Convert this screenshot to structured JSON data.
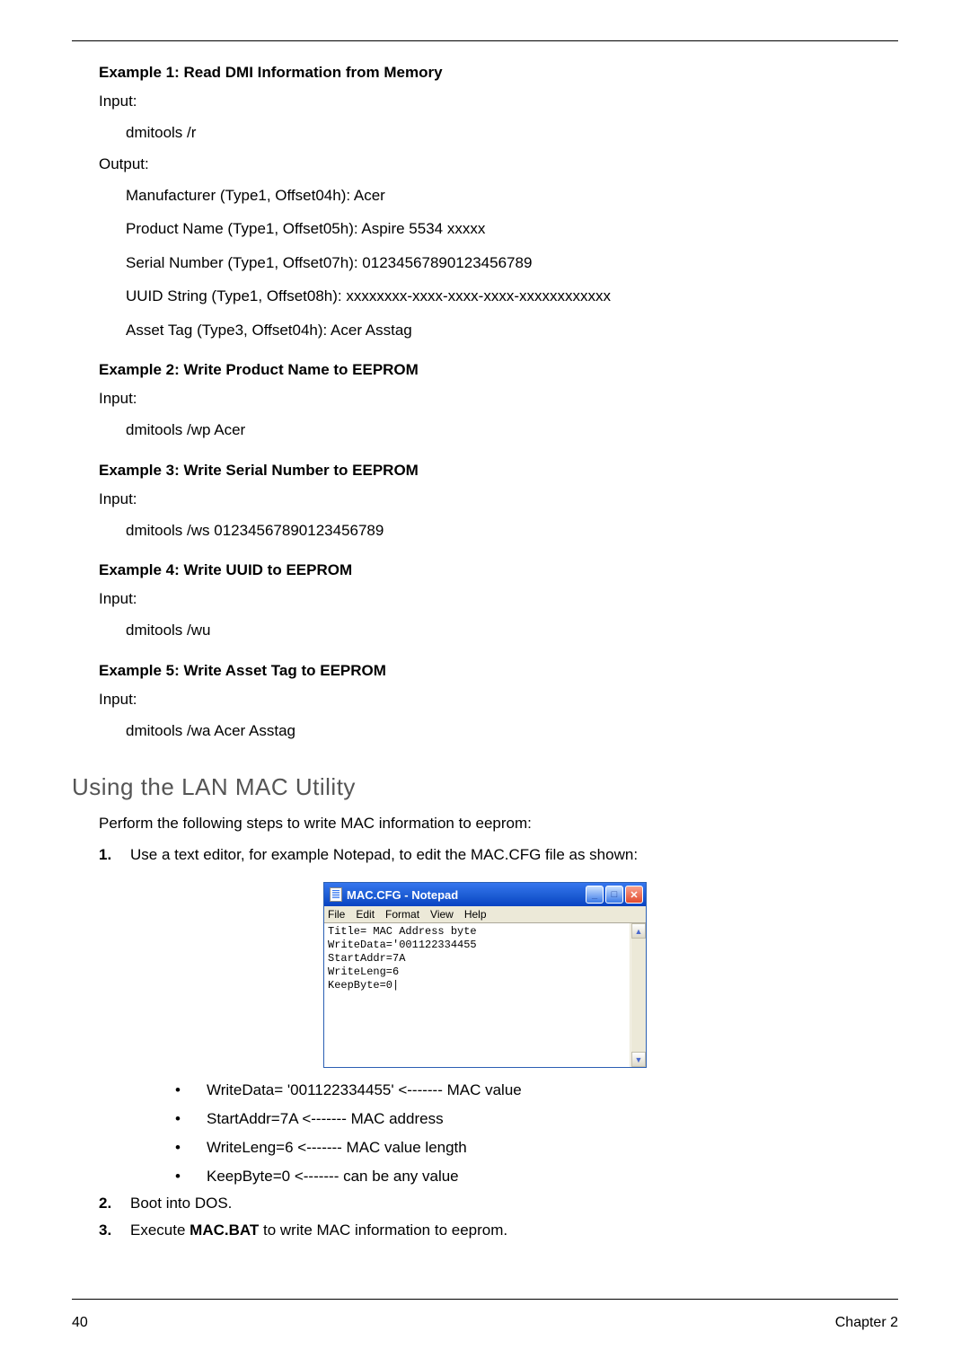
{
  "example1": {
    "heading": "Example 1: Read DMI Information from Memory",
    "inputLabel": "Input:",
    "inputCmd": "dmitools /r",
    "outputLabel": "Output:",
    "outputLines": [
      "Manufacturer (Type1, Offset04h): Acer",
      "Product Name (Type1, Offset05h): Aspire 5534 xxxxx",
      "Serial Number (Type1, Offset07h): 01234567890123456789",
      "UUID String (Type1, Offset08h): xxxxxxxx-xxxx-xxxx-xxxx-xxxxxxxxxxxx",
      "Asset Tag (Type3, Offset04h): Acer Asstag"
    ]
  },
  "example2": {
    "heading": "Example 2: Write Product Name to EEPROM",
    "inputLabel": "Input:",
    "inputCmd": "dmitools /wp Acer"
  },
  "example3": {
    "heading": "Example 3: Write Serial Number to EEPROM",
    "inputLabel": "Input:",
    "inputCmd": "dmitools /ws 01234567890123456789"
  },
  "example4": {
    "heading": "Example 4: Write UUID to EEPROM",
    "inputLabel": "Input:",
    "inputCmd": "dmitools /wu"
  },
  "example5": {
    "heading": "Example 5: Write Asset Tag to EEPROM",
    "inputLabel": "Input:",
    "inputCmd": "dmitools /wa Acer Asstag"
  },
  "lanSection": {
    "heading": "Using the LAN MAC Utility",
    "intro": "Perform the following steps to write MAC information to eeprom:",
    "step1": {
      "num": "1.",
      "text": "Use a text editor, for example Notepad, to edit the MAC.CFG file as shown:"
    },
    "step2": {
      "num": "2.",
      "text": "Boot into DOS."
    },
    "step3": {
      "num": "3.",
      "textPrefix": "Execute ",
      "bold": "MAC.BAT",
      "textSuffix": " to write MAC information to eeprom."
    },
    "bullets": [
      "WriteData= '001122334455' <------- MAC value",
      "StartAddr=7A <------- MAC address",
      "WriteLeng=6 <------- MAC value length",
      "KeepByte=0 <------- can be any value"
    ]
  },
  "notepad": {
    "title": "MAC.CFG - Notepad",
    "menus": [
      "File",
      "Edit",
      "Format",
      "View",
      "Help"
    ],
    "content": "Title= MAC Address byte\nWriteData='001122334455\nStartAddr=7A\nWriteLeng=6\nKeepByte=0|"
  },
  "footer": {
    "pageNum": "40",
    "chapter": "Chapter 2"
  }
}
